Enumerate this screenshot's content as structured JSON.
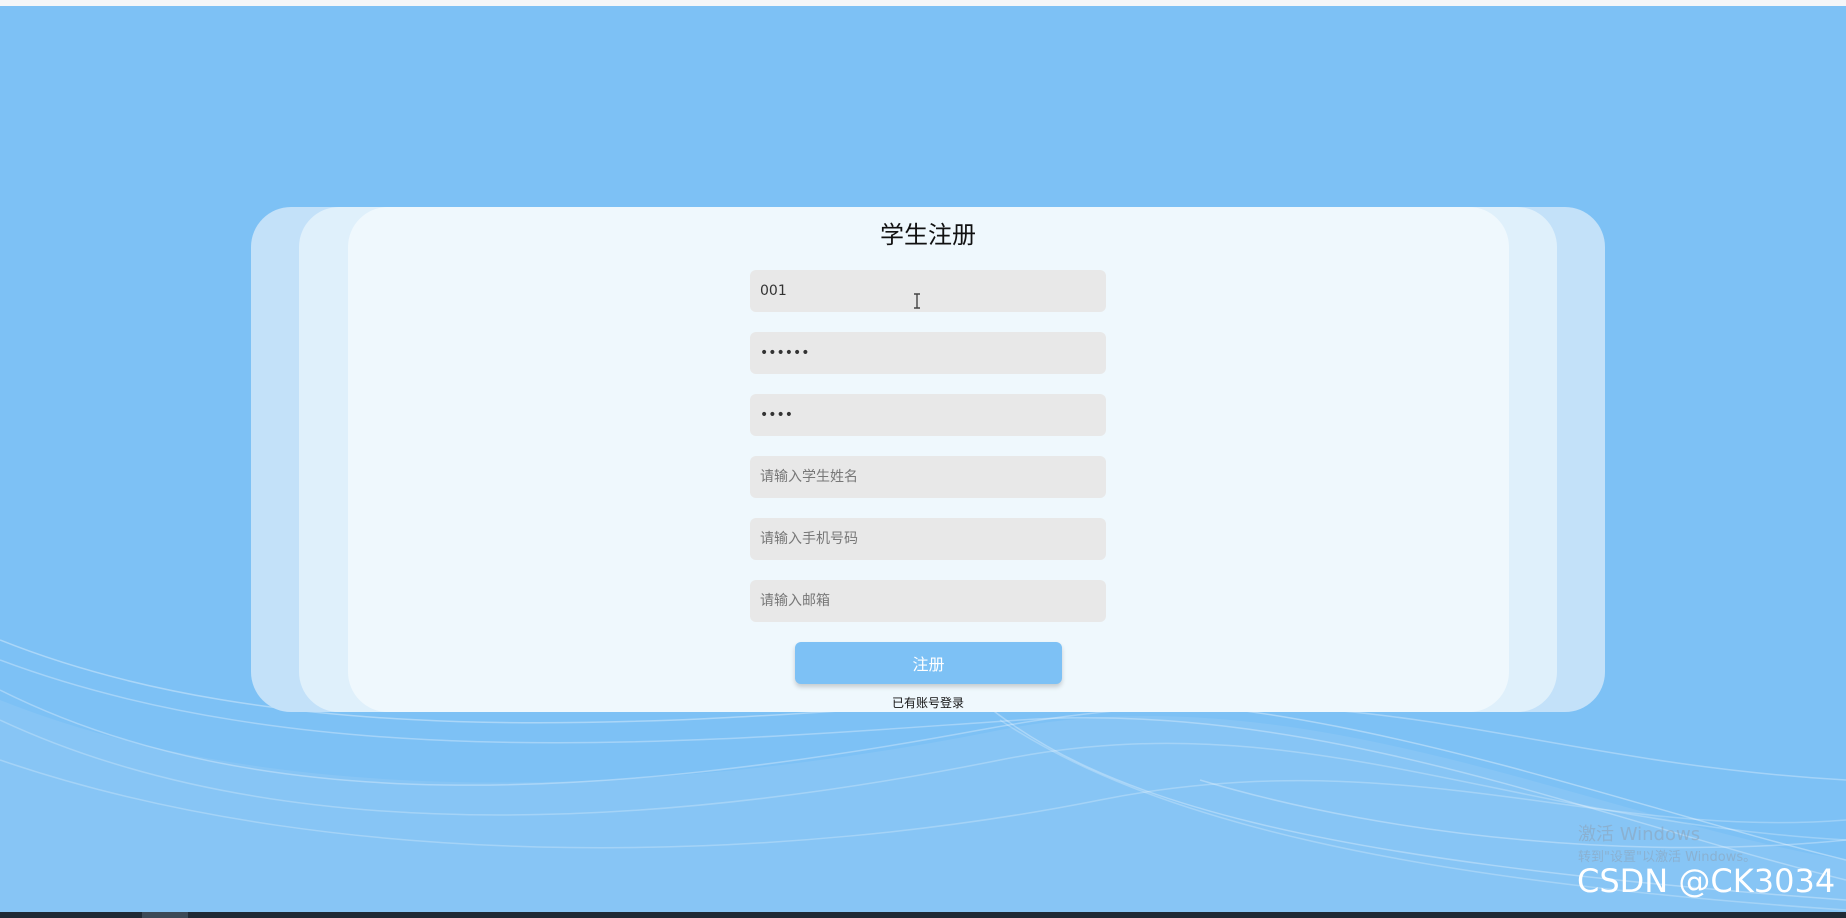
{
  "page": {
    "title": "学生注册"
  },
  "form": {
    "student_id": {
      "value": "001",
      "placeholder": ""
    },
    "password": {
      "value": "123456",
      "placeholder": ""
    },
    "confirm_password": {
      "value": "1234",
      "placeholder": ""
    },
    "name": {
      "value": "",
      "placeholder": "请输入学生姓名"
    },
    "phone": {
      "value": "",
      "placeholder": "请输入手机号码"
    },
    "email": {
      "value": "",
      "placeholder": "请输入邮箱"
    },
    "submit_label": "注册",
    "login_link_label": "已有账号登录"
  },
  "watermarks": {
    "windows_title": "激活 Windows",
    "windows_sub": "转到\"设置\"以激活 Windows。",
    "csdn": "CSDN @CK3034"
  },
  "colors": {
    "background": "#7dc1f5",
    "button": "#7dc1f5",
    "card_front": "#eff8fd",
    "field": "#e8e8e8"
  },
  "icons": {
    "cursor": "text-cursor-icon"
  }
}
